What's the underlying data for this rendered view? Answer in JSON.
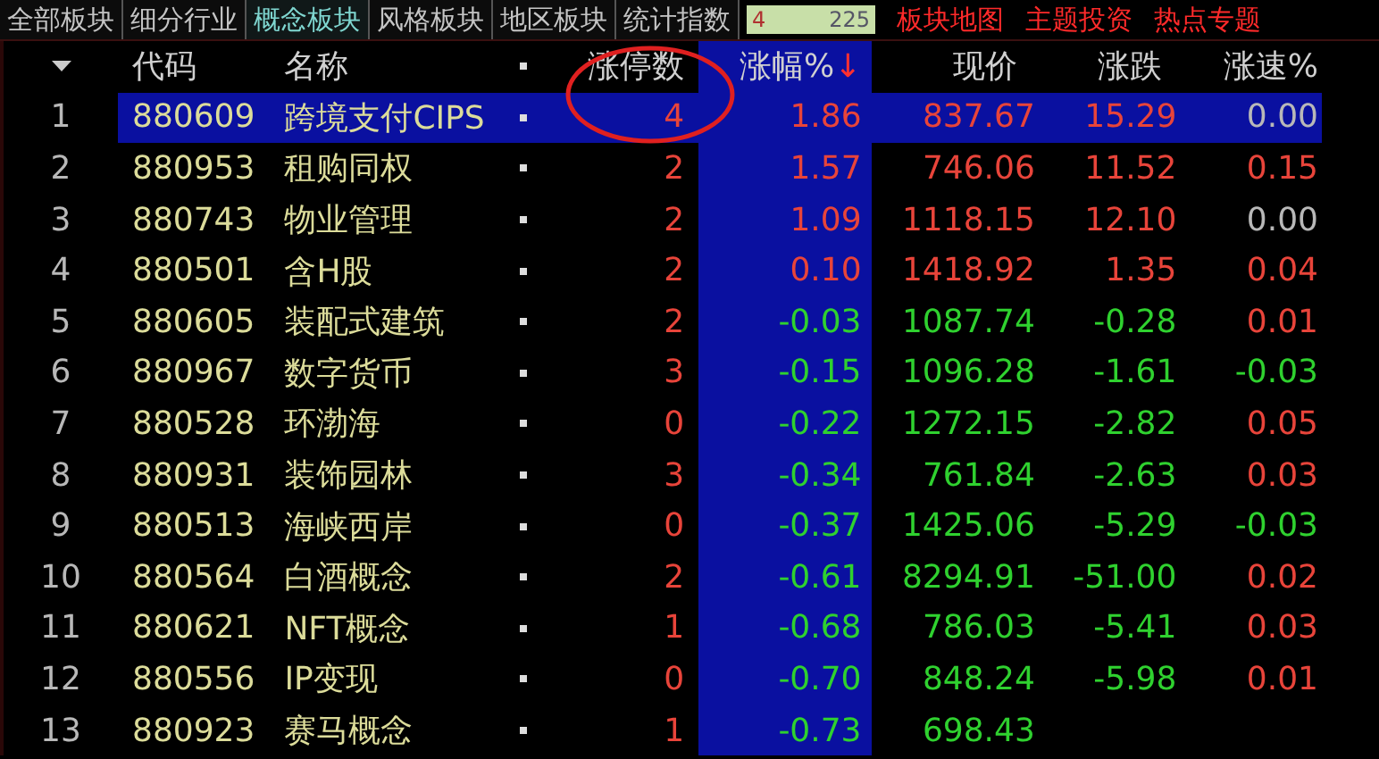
{
  "tabs": [
    {
      "label": "全部板块",
      "selected": false
    },
    {
      "label": "细分行业",
      "selected": false
    },
    {
      "label": "概念板块",
      "selected": true
    },
    {
      "label": "风格板块",
      "selected": false
    },
    {
      "label": "地区板块",
      "selected": false
    },
    {
      "label": "统计指数",
      "selected": false
    }
  ],
  "counter": {
    "current": "4",
    "total": "225"
  },
  "links": [
    "板块地图",
    "主题投资",
    "热点专题"
  ],
  "columns": [
    {
      "label": "代码",
      "sorted": false
    },
    {
      "label": "名称",
      "sorted": false
    },
    {
      "label": "涨停数",
      "sorted": false
    },
    {
      "label": "涨幅%",
      "sorted": true,
      "sort_arrow": "↓"
    },
    {
      "label": "现价",
      "sorted": false
    },
    {
      "label": "涨跌",
      "sorted": false
    },
    {
      "label": "涨速%",
      "sorted": false
    }
  ],
  "rows": [
    {
      "index": "1",
      "code": "880609",
      "name": "跨境支付CIPS",
      "limit_ups": "4",
      "pct": "1.86",
      "price": "837.67",
      "change": "15.29",
      "speed": {
        "value": "0.00",
        "color": "#b8b8b8"
      },
      "color": "#e8443a",
      "selected": true
    },
    {
      "index": "2",
      "code": "880953",
      "name": "租购同权",
      "limit_ups": "2",
      "pct": "1.57",
      "price": "746.06",
      "change": "11.52",
      "speed": {
        "value": "0.15",
        "color": "#e8443a"
      },
      "color": "#e8443a",
      "selected": false
    },
    {
      "index": "3",
      "code": "880743",
      "name": "物业管理",
      "limit_ups": "2",
      "pct": "1.09",
      "price": "1118.15",
      "change": "12.10",
      "speed": {
        "value": "0.00",
        "color": "#b8b8b8"
      },
      "color": "#e8443a",
      "selected": false
    },
    {
      "index": "4",
      "code": "880501",
      "name": "含H股",
      "limit_ups": "2",
      "pct": "0.10",
      "price": "1418.92",
      "change": "1.35",
      "speed": {
        "value": "0.04",
        "color": "#e8443a"
      },
      "color": "#e8443a",
      "selected": false
    },
    {
      "index": "5",
      "code": "880605",
      "name": "装配式建筑",
      "limit_ups": "2",
      "pct": "-0.03",
      "price": "1087.74",
      "change": "-0.28",
      "speed": {
        "value": "0.01",
        "color": "#e8443a"
      },
      "color": "#2fd12f",
      "selected": false
    },
    {
      "index": "6",
      "code": "880967",
      "name": "数字货币",
      "limit_ups": "3",
      "pct": "-0.15",
      "price": "1096.28",
      "change": "-1.61",
      "speed": {
        "value": "-0.03",
        "color": "#2fd12f"
      },
      "color": "#2fd12f",
      "selected": false
    },
    {
      "index": "7",
      "code": "880528",
      "name": "环渤海",
      "limit_ups": "0",
      "pct": "-0.22",
      "price": "1272.15",
      "change": "-2.82",
      "speed": {
        "value": "0.05",
        "color": "#e8443a"
      },
      "color": "#2fd12f",
      "selected": false
    },
    {
      "index": "8",
      "code": "880931",
      "name": "装饰园林",
      "limit_ups": "3",
      "pct": "-0.34",
      "price": "761.84",
      "change": "-2.63",
      "speed": {
        "value": "0.03",
        "color": "#e8443a"
      },
      "color": "#2fd12f",
      "selected": false
    },
    {
      "index": "9",
      "code": "880513",
      "name": "海峡西岸",
      "limit_ups": "0",
      "pct": "-0.37",
      "price": "1425.06",
      "change": "-5.29",
      "speed": {
        "value": "-0.03",
        "color": "#2fd12f"
      },
      "color": "#2fd12f",
      "selected": false
    },
    {
      "index": "10",
      "code": "880564",
      "name": "白酒概念",
      "limit_ups": "2",
      "pct": "-0.61",
      "price": "8294.91",
      "change": "-51.00",
      "speed": {
        "value": "0.02",
        "color": "#e8443a"
      },
      "color": "#2fd12f",
      "selected": false
    },
    {
      "index": "11",
      "code": "880621",
      "name": "NFT概念",
      "limit_ups": "1",
      "pct": "-0.68",
      "price": "786.03",
      "change": "-5.41",
      "speed": {
        "value": "0.03",
        "color": "#e8443a"
      },
      "color": "#2fd12f",
      "selected": false
    },
    {
      "index": "12",
      "code": "880556",
      "name": "IP变现",
      "limit_ups": "0",
      "pct": "-0.70",
      "price": "848.24",
      "change": "-5.98",
      "speed": {
        "value": "0.01",
        "color": "#e8443a"
      },
      "color": "#2fd12f",
      "selected": false
    },
    {
      "index": "13",
      "code": "880923",
      "name": "赛马概念",
      "limit_ups": "1",
      "pct": "-0.73",
      "price": "698.43",
      "color": "#2fd12f",
      "selected": false
    }
  ]
}
